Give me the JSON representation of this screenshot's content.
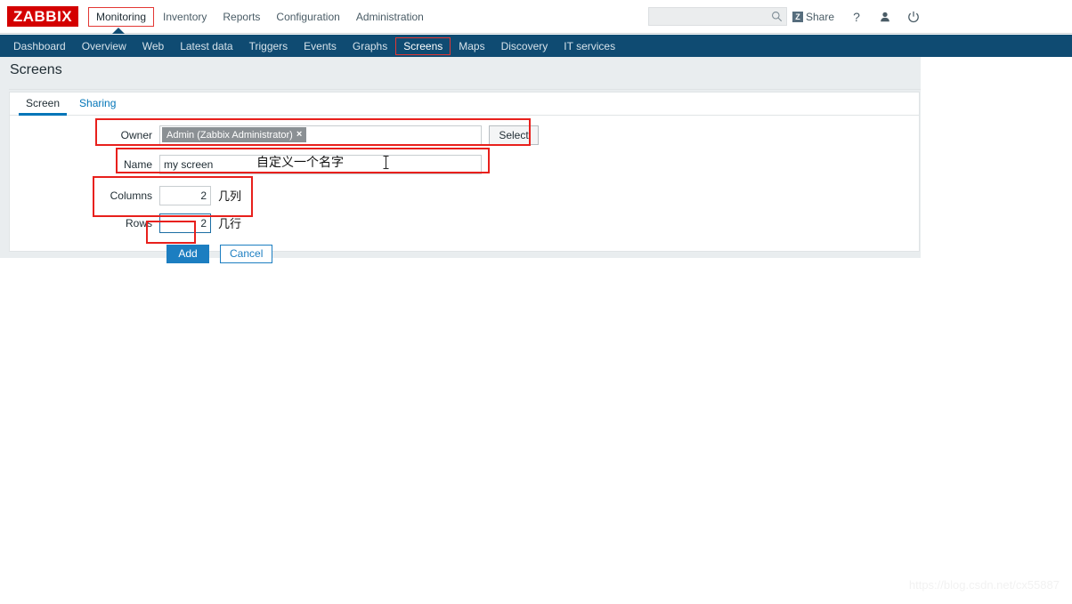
{
  "header": {
    "logo_text": "ZABBIX",
    "main_menu": [
      {
        "label": "Monitoring",
        "selected": true
      },
      {
        "label": "Inventory",
        "selected": false
      },
      {
        "label": "Reports",
        "selected": false
      },
      {
        "label": "Configuration",
        "selected": false
      },
      {
        "label": "Administration",
        "selected": false
      }
    ],
    "search": {
      "value": "",
      "placeholder": ""
    },
    "share_label": "Share",
    "share_icon_letter": "Z",
    "help_label": "?",
    "icons": [
      "search-icon",
      "share-icon",
      "help-icon",
      "user-icon",
      "power-icon"
    ]
  },
  "subnav": {
    "items": [
      {
        "label": "Dashboard",
        "selected": false
      },
      {
        "label": "Overview",
        "selected": false
      },
      {
        "label": "Web",
        "selected": false
      },
      {
        "label": "Latest data",
        "selected": false
      },
      {
        "label": "Triggers",
        "selected": false
      },
      {
        "label": "Events",
        "selected": false
      },
      {
        "label": "Graphs",
        "selected": false
      },
      {
        "label": "Screens",
        "selected": true
      },
      {
        "label": "Maps",
        "selected": false
      },
      {
        "label": "Discovery",
        "selected": false
      },
      {
        "label": "IT services",
        "selected": false
      }
    ]
  },
  "page": {
    "title": "Screens"
  },
  "tabs": [
    {
      "label": "Screen",
      "active": true
    },
    {
      "label": "Sharing",
      "active": false
    }
  ],
  "form": {
    "owner": {
      "label": "Owner",
      "chip_text": "Admin (Zabbix Administrator)",
      "chip_remove": "×",
      "select_button": "Select",
      "input_value": ""
    },
    "name": {
      "label": "Name",
      "value": "my screen",
      "placeholder": "",
      "annotation": "自定义一个名字"
    },
    "columns": {
      "label": "Columns",
      "value": "2",
      "annotation": "几列"
    },
    "rows": {
      "label": "Rows",
      "value": "2",
      "annotation": "几行"
    },
    "buttons": {
      "add": "Add",
      "cancel": "Cancel"
    }
  },
  "watermark": "https://blog.csdn.net/cx55887",
  "colors": {
    "brand_red": "#d40000",
    "nav_blue": "#0f4b72",
    "accent_blue": "#1c7ec1",
    "link_blue": "#0275b8",
    "annotation_red": "#e8201c",
    "chip_grey": "#8b9094"
  }
}
